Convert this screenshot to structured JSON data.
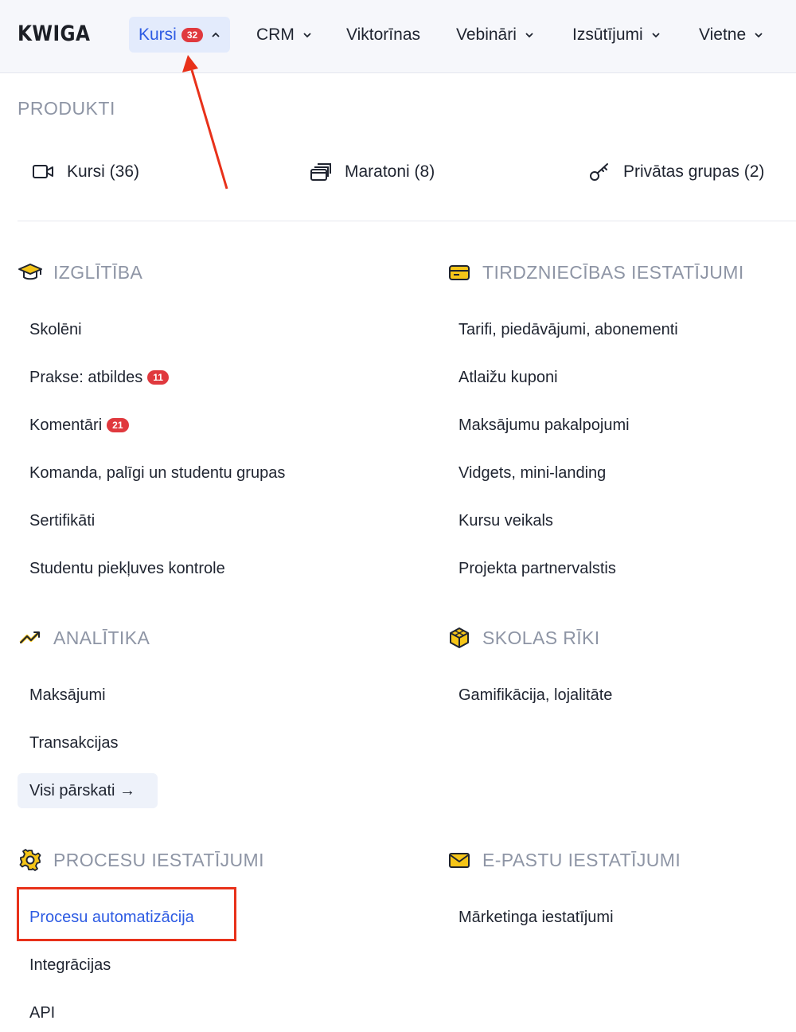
{
  "brand": {
    "logo": "KWIGA"
  },
  "nav": {
    "items": [
      {
        "label": "Kursi",
        "badge": "32",
        "active": true,
        "chevron": "chevron-up-icon"
      },
      {
        "label": "CRM",
        "chevron": "chevron-down-icon"
      },
      {
        "label": "Viktorīnas"
      },
      {
        "label": "Vebināri",
        "chevron": "chevron-down-icon"
      },
      {
        "label": "Izsūtījumi",
        "chevron": "chevron-down-icon"
      },
      {
        "label": "Vietne",
        "chevron": "chevron-down-icon"
      }
    ]
  },
  "products": {
    "title": "PRODUKTI",
    "items": [
      {
        "label": "Kursi (36)",
        "icon": "video-camera-icon"
      },
      {
        "label": "Maratoni (8)",
        "icon": "stacked-cards-icon"
      },
      {
        "label": "Privātas grupas (2)",
        "icon": "key-icon"
      }
    ]
  },
  "education": {
    "title": "IZGLĪTĪBA",
    "icon": "graduation-cap-icon",
    "links": [
      {
        "label": "Skolēni"
      },
      {
        "label": "Prakse: atbildes",
        "badge": "11"
      },
      {
        "label": "Komentāri",
        "badge": "21"
      },
      {
        "label": "Komanda, palīgi un studentu grupas"
      },
      {
        "label": "Sertifikāti"
      },
      {
        "label": "Studentu piekļuves kontrole"
      }
    ]
  },
  "sales": {
    "title": "TIRDZNIECĪBAS IESTATĪJUMI",
    "icon": "credit-card-icon",
    "links": [
      {
        "label": "Tarifi, piedāvājumi, abonementi"
      },
      {
        "label": "Atlaižu kuponi"
      },
      {
        "label": "Maksājumu pakalpojumi"
      },
      {
        "label": "Vidgets, mini-landing"
      },
      {
        "label": "Kursu veikals"
      },
      {
        "label": "Projekta partnervalstis"
      }
    ]
  },
  "analytics": {
    "title": "ANALĪTIKA",
    "icon": "trending-up-icon",
    "links": [
      {
        "label": "Maksājumi"
      },
      {
        "label": "Transakcijas"
      }
    ],
    "all_reports": "Visi pārskati →"
  },
  "school_tools": {
    "title": "SKOLAS RĪKI",
    "icon": "cube-icon",
    "links": [
      {
        "label": "Gamifikācija, lojalitāte"
      }
    ]
  },
  "process": {
    "title": "PROCESU IESTATĪJUMI",
    "icon": "gear-icon",
    "links": [
      {
        "label": "Procesu automatizācija",
        "highlighted": true
      },
      {
        "label": "Integrācijas"
      },
      {
        "label": "API"
      }
    ]
  },
  "email": {
    "title": "E-PASTU IESTATĪJUMI",
    "icon": "envelope-icon",
    "links": [
      {
        "label": "Mārketinga iestatījumi"
      }
    ]
  },
  "colors": {
    "accent": "#2d5be3",
    "badge": "#e0393e",
    "icon_yellow": "#f5c518",
    "annotation_red": "#e8311a"
  }
}
